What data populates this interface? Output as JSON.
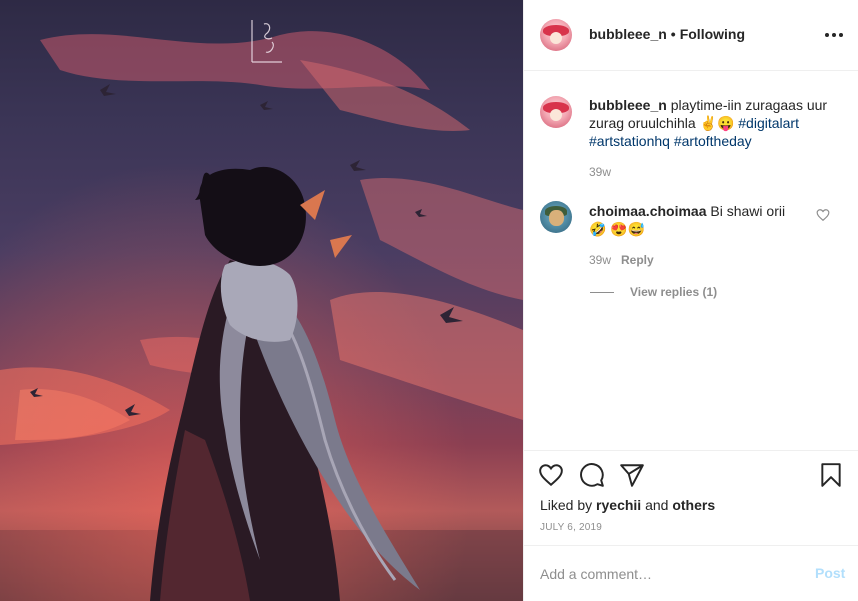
{
  "post": {
    "username": "bubbleee_n",
    "separator": "•",
    "follow_status": "Following"
  },
  "caption": {
    "username": "bubbleee_n",
    "text": "playtime-iin zuragaas uur zurag oruulchihla ✌😛 ",
    "hashtags": [
      "#digitalart",
      "#artstationhq",
      "#artoftheday"
    ],
    "age": "39w"
  },
  "comment": {
    "username": "choimaa.choimaa",
    "text": "Bi shawi orii 🤣 😍😅",
    "age": "39w",
    "reply_label": "Reply",
    "view_replies": "View replies (1)"
  },
  "likes": {
    "prefix": "Liked by",
    "user": "ryechii",
    "and": "and",
    "others": "others"
  },
  "date": "JULY 6, 2019",
  "add_comment": {
    "placeholder": "Add a comment…",
    "post_label": "Post"
  },
  "colors": {
    "hashtag": "#00376b",
    "post_button": "#b2dffc",
    "muted": "#8e8e8e"
  },
  "icons": [
    "more-icon",
    "heart-icon",
    "comment-icon",
    "share-icon",
    "bookmark-icon"
  ]
}
